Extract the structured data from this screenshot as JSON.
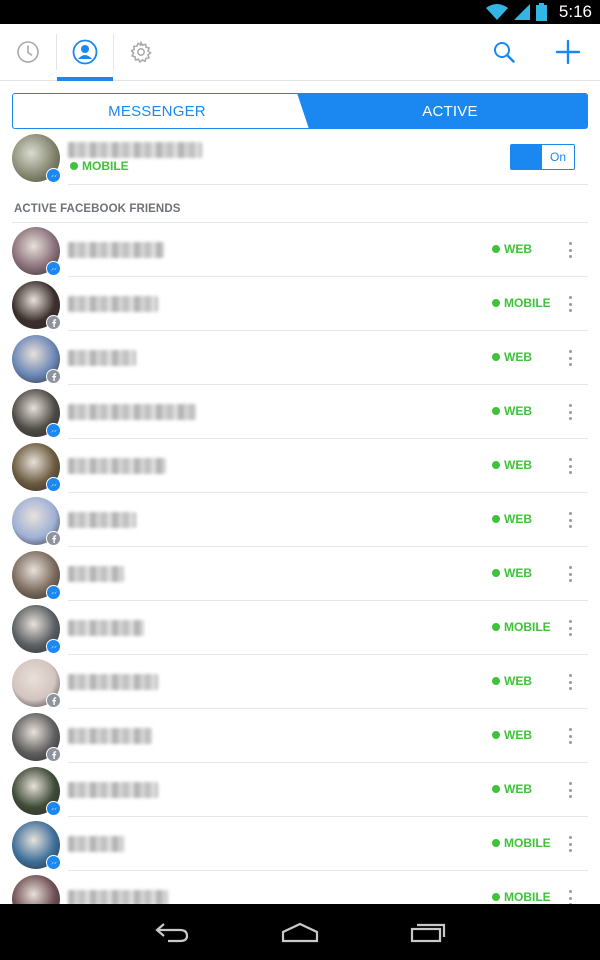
{
  "status_bar": {
    "time": "5:16",
    "icons": [
      "wifi-icon",
      "signal-icon",
      "battery-icon"
    ]
  },
  "top_bar": {
    "tabs": [
      {
        "name": "recent",
        "icon": "clock-icon",
        "active": false
      },
      {
        "name": "people",
        "icon": "person-icon",
        "active": true
      },
      {
        "name": "settings",
        "icon": "gear-icon",
        "active": false
      }
    ],
    "actions": [
      {
        "name": "search",
        "icon": "search-icon"
      },
      {
        "name": "add",
        "icon": "plus-icon"
      }
    ]
  },
  "segmented_control": {
    "left_label": "MESSENGER",
    "right_label": "ACTIVE",
    "selected": "ACTIVE"
  },
  "me": {
    "status": "MOBILE",
    "toggle_label": "On",
    "toggle_on": true,
    "badge": "messenger"
  },
  "section_header": "ACTIVE FACEBOOK FRIENDS",
  "friends": [
    {
      "status": "WEB",
      "badge": "messenger",
      "avatar_color": "#8a6f7b"
    },
    {
      "status": "MOBILE",
      "badge": "facebook",
      "avatar_color": "#3b2f2c"
    },
    {
      "status": "WEB",
      "badge": "facebook",
      "avatar_color": "#6a86b5"
    },
    {
      "status": "WEB",
      "badge": "messenger",
      "avatar_color": "#4e4a45"
    },
    {
      "status": "WEB",
      "badge": "messenger",
      "avatar_color": "#6b5a3f"
    },
    {
      "status": "WEB",
      "badge": "facebook",
      "avatar_color": "#9fb1d6"
    },
    {
      "status": "WEB",
      "badge": "messenger",
      "avatar_color": "#7b6a5d"
    },
    {
      "status": "MOBILE",
      "badge": "messenger",
      "avatar_color": "#5a5f63"
    },
    {
      "status": "WEB",
      "badge": "facebook",
      "avatar_color": "#d3c4bf"
    },
    {
      "status": "WEB",
      "badge": "facebook",
      "avatar_color": "#5e5e5e"
    },
    {
      "status": "WEB",
      "badge": "messenger",
      "avatar_color": "#3e4a36"
    },
    {
      "status": "MOBILE",
      "badge": "messenger",
      "avatar_color": "#3e6f9a"
    },
    {
      "status": "MOBILE",
      "badge": "messenger",
      "avatar_color": "#6e4e52"
    }
  ],
  "colors": {
    "accent": "#1a88f0",
    "online": "#3fc33a",
    "section_text": "#6f7378"
  },
  "nav_bar": {
    "buttons": [
      "back-icon",
      "home-icon",
      "recents-icon"
    ]
  }
}
